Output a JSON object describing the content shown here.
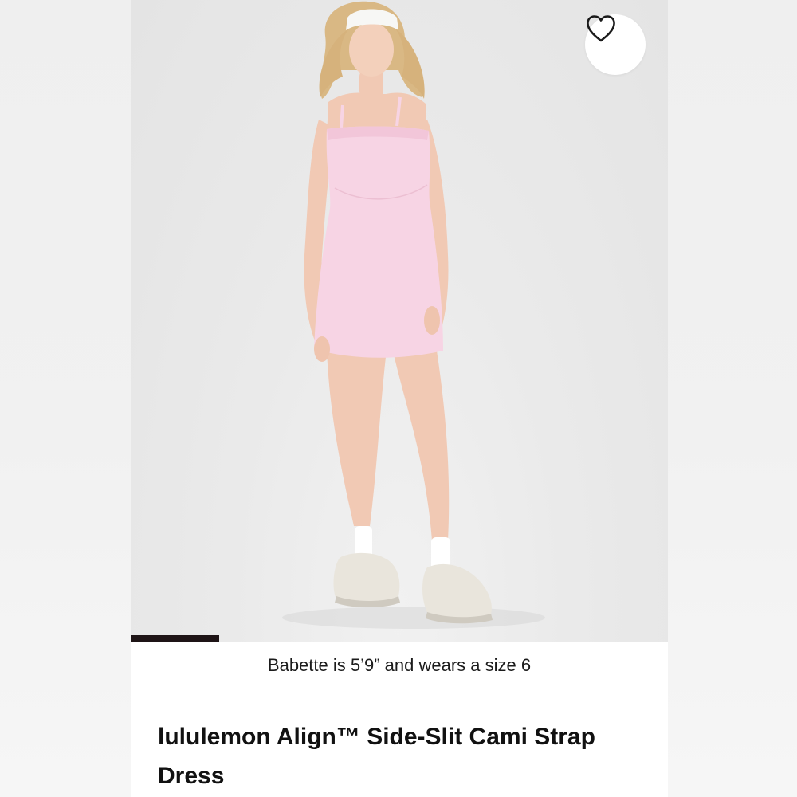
{
  "product": {
    "title": "lululemon Align™ Side-Slit Cami Strap Dress",
    "model_note": "Babette is 5’9” and wears a size 6"
  },
  "gallery": {
    "image_count_progress": 0.165,
    "favorite_icon": "heart-outline-icon"
  },
  "colors": {
    "dress": "#f7d4e4",
    "progress": "#1e1416",
    "background": "#e8e8e8"
  }
}
